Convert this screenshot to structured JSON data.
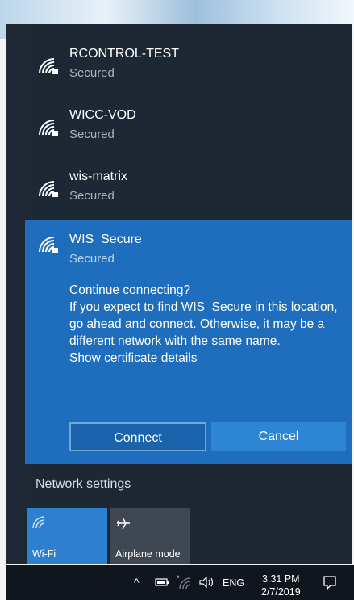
{
  "networks": [
    {
      "name": "RCONTROL-TEST",
      "status": "Secured"
    },
    {
      "name": "WICC-VOD",
      "status": "Secured"
    },
    {
      "name": "wis-matrix",
      "status": "Secured"
    }
  ],
  "selected_network": {
    "name": "WIS_Secure",
    "status": "Secured",
    "prompt_title": "Continue connecting?",
    "prompt_body": "If you expect to find WIS_Secure in this location, go ahead and connect. Otherwise, it may be a different network with the same name.",
    "cert_link": "Show certificate details",
    "connect_label": "Connect",
    "cancel_label": "Cancel"
  },
  "network_settings_label": "Network settings",
  "quick_actions": [
    {
      "label": "Wi-Fi",
      "icon": "wifi-icon",
      "active": true
    },
    {
      "label": "Airplane mode",
      "icon": "airplane-icon",
      "active": false
    }
  ],
  "taskbar": {
    "language": "ENG",
    "time": "3:31 PM",
    "date": "2/7/2019"
  },
  "colors": {
    "panel_bg": "#1e2835",
    "selected_bg": "#1f6ebd",
    "accent": "#2f7fd0"
  }
}
